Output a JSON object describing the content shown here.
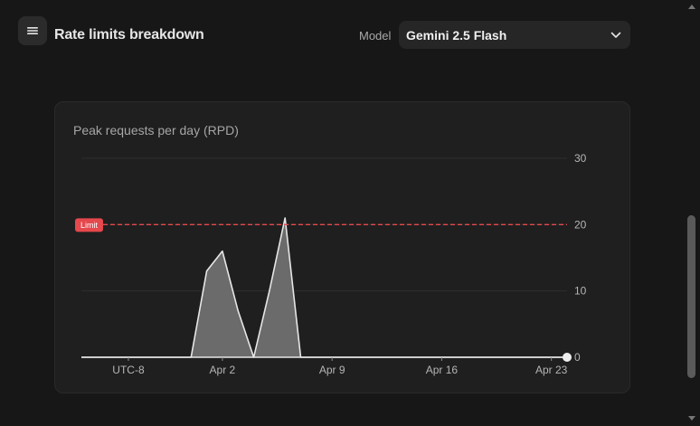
{
  "header": {
    "title": "Rate limits breakdown",
    "model_label": "Model",
    "model_value": "Gemini 2.5 Flash"
  },
  "card": {
    "title": "Peak requests per day (RPD)"
  },
  "chart_data": {
    "type": "area",
    "title": "Peak requests per day (RPD)",
    "x_unit": "days",
    "x_tick_labels": [
      "UTC-8",
      "Apr 2",
      "Apr 9",
      "Apr 16",
      "Apr 23"
    ],
    "x_tick_values": [
      -4,
      2,
      9,
      16,
      23
    ],
    "xlim": [
      -7,
      24
    ],
    "x": [
      -7,
      0,
      1,
      2,
      3,
      4,
      5,
      6,
      7,
      8,
      9,
      10,
      24
    ],
    "values": [
      0,
      0,
      13,
      16,
      7,
      0,
      10,
      21,
      0,
      0,
      0,
      0,
      0
    ],
    "ylim": [
      0,
      30
    ],
    "y_ticks": [
      0,
      10,
      20,
      30
    ],
    "y_axis_side": "right",
    "limit": {
      "value": 20,
      "label": "Limit",
      "color": "#e5484d"
    },
    "grid": true,
    "colors": {
      "line": "#e6e6e6",
      "fill": "#6b6b6b"
    }
  }
}
